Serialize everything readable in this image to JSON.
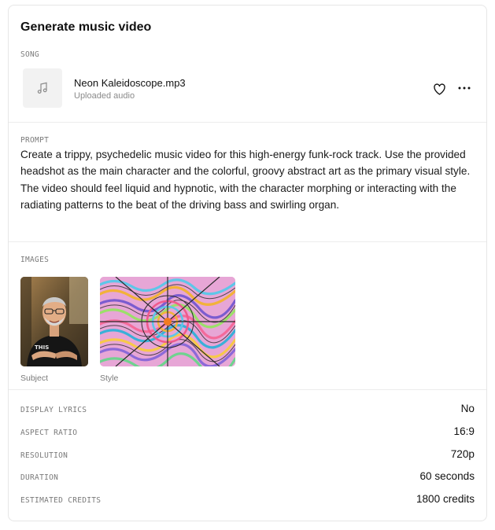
{
  "card": {
    "title": "Generate music video"
  },
  "song": {
    "caption": "SONG",
    "file_name": "Neon Kaleidoscope.mp3",
    "subtitle": "Uploaded audio"
  },
  "prompt": {
    "caption": "PROMPT",
    "text": "Create a trippy, psychedelic music video for this high-energy funk-rock track. Use the provided headshot as the main character and the colorful, groovy abstract art as the primary visual style. The video should feel liquid and hypnotic, with the character morphing or interacting with the radiating patterns to the beat of the driving bass and swirling organ."
  },
  "images": {
    "caption": "IMAGES",
    "items": [
      {
        "label": "Subject",
        "shirt_text": "THIS"
      },
      {
        "label": "Style"
      }
    ]
  },
  "settings": [
    {
      "label": "DISPLAY LYRICS",
      "value": "No"
    },
    {
      "label": "ASPECT RATIO",
      "value": "16:9"
    },
    {
      "label": "RESOLUTION",
      "value": "720p"
    },
    {
      "label": "DURATION",
      "value": "60 seconds"
    },
    {
      "label": "ESTIMATED CREDITS",
      "value": "1800 credits"
    }
  ],
  "icons": {
    "song_thumb": "music-note-icon",
    "favorite": "heart-icon",
    "more": "more-horizontal-icon"
  },
  "colors": {
    "text_primary": "#111111",
    "text_muted": "#7a7a7a",
    "border": "#e6e6e6"
  }
}
